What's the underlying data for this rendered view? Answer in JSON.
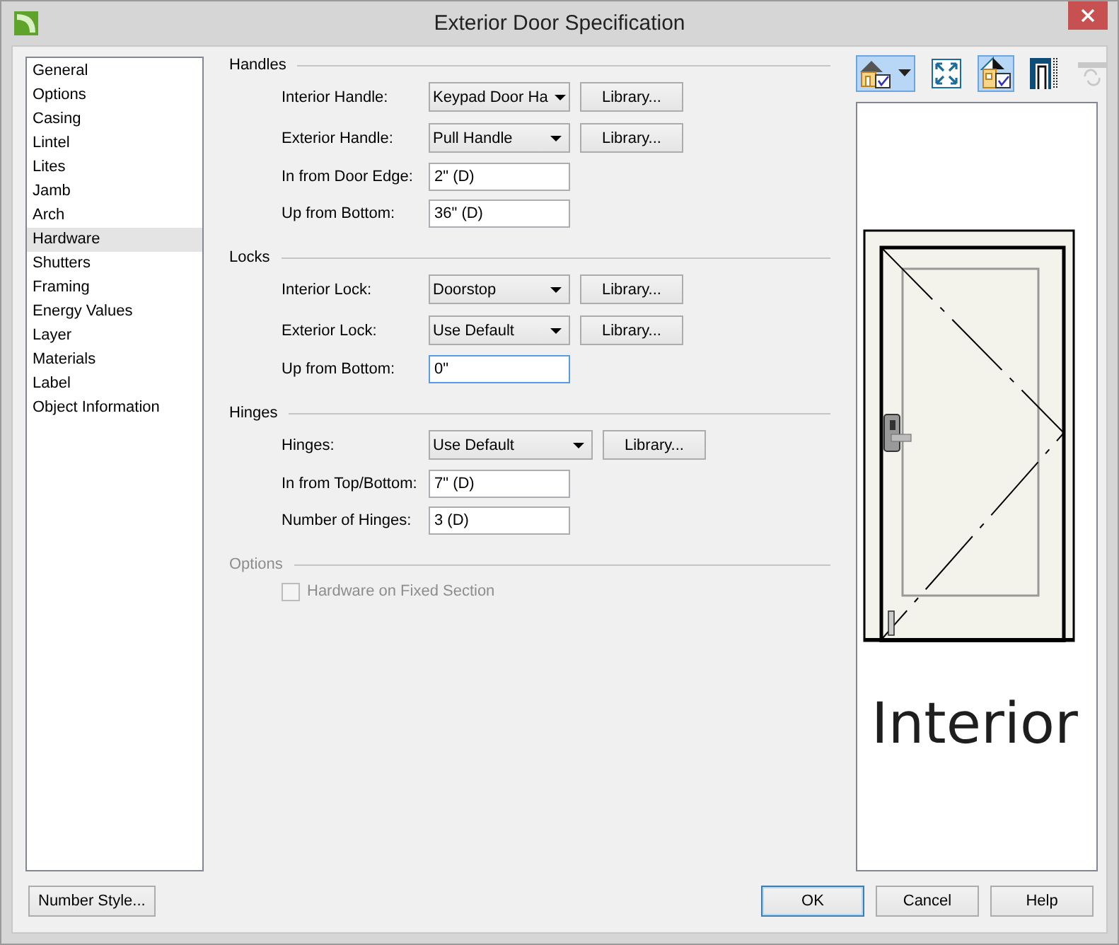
{
  "window": {
    "title": "Exterior Door Specification"
  },
  "sidebar": {
    "items": [
      {
        "label": "General",
        "selected": false
      },
      {
        "label": "Options",
        "selected": false
      },
      {
        "label": "Casing",
        "selected": false
      },
      {
        "label": "Lintel",
        "selected": false
      },
      {
        "label": "Lites",
        "selected": false
      },
      {
        "label": "Jamb",
        "selected": false
      },
      {
        "label": "Arch",
        "selected": false
      },
      {
        "label": "Hardware",
        "selected": true
      },
      {
        "label": "Shutters",
        "selected": false
      },
      {
        "label": "Framing",
        "selected": false
      },
      {
        "label": "Energy Values",
        "selected": false
      },
      {
        "label": "Layer",
        "selected": false
      },
      {
        "label": "Materials",
        "selected": false
      },
      {
        "label": "Label",
        "selected": false
      },
      {
        "label": "Object Information",
        "selected": false
      }
    ]
  },
  "sections": [
    {
      "title": "Handles",
      "disabled": false,
      "rows": [
        {
          "kind": "dropdown",
          "label": "Interior Handle:",
          "value": "Keypad Door Ha",
          "button": "Library..."
        },
        {
          "kind": "dropdown",
          "label": "Exterior Handle:",
          "value": "Pull Handle",
          "button": "Library..."
        },
        {
          "kind": "input",
          "label": "In from Door Edge:",
          "value": "2\" (D)",
          "focused": false
        },
        {
          "kind": "input",
          "label": "Up from Bottom:",
          "value": "36\" (D)",
          "focused": false
        }
      ]
    },
    {
      "title": "Locks",
      "disabled": false,
      "rows": [
        {
          "kind": "dropdown",
          "label": "Interior Lock:",
          "value": "Doorstop",
          "button": "Library..."
        },
        {
          "kind": "dropdown",
          "label": "Exterior Lock:",
          "value": "Use Default",
          "button": "Library..."
        },
        {
          "kind": "input",
          "label": "Up from Bottom:",
          "value": "0\"",
          "focused": true
        }
      ]
    },
    {
      "title": "Hinges",
      "disabled": false,
      "rows": [
        {
          "kind": "dropdown",
          "label": "Hinges:",
          "value": "Use Default",
          "button": "Library..."
        },
        {
          "kind": "input",
          "label": "In from Top/Bottom:",
          "value": "7\" (D)",
          "focused": false
        },
        {
          "kind": "input",
          "label": "Number of Hinges:",
          "value": "3 (D)",
          "focused": false
        }
      ]
    },
    {
      "title": "Options",
      "disabled": true,
      "rows": [
        {
          "kind": "checkbox",
          "label": "Hardware on Fixed Section",
          "checked": false
        }
      ]
    }
  ],
  "preview": {
    "tools": [
      {
        "on": true,
        "disabled": false
      },
      {
        "on": false,
        "disabled": false
      },
      {
        "on": true,
        "disabled": false
      },
      {
        "on": false,
        "disabled": false
      },
      {
        "on": false,
        "disabled": true
      }
    ],
    "view_label": "Interior"
  },
  "footer": {
    "number_style_button": "Number Style...",
    "buttons": [
      {
        "label": "OK",
        "default": true
      },
      {
        "label": "Cancel",
        "default": false
      },
      {
        "label": "Help",
        "default": false
      }
    ]
  }
}
